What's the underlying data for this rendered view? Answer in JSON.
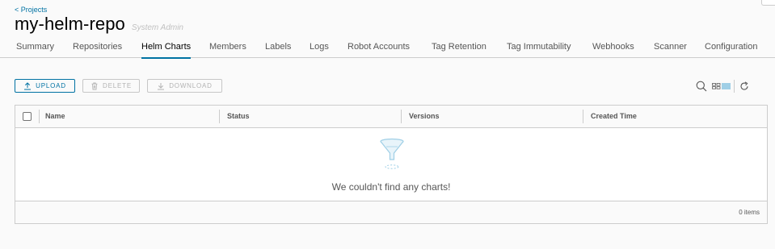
{
  "breadcrumb": {
    "back_label": "< Projects"
  },
  "project": {
    "name": "my-helm-repo",
    "role": "System Admin"
  },
  "tabs": [
    {
      "label": "Summary"
    },
    {
      "label": "Repositories"
    },
    {
      "label": "Helm Charts",
      "active": true
    },
    {
      "label": "Members"
    },
    {
      "label": "Labels"
    },
    {
      "label": "Logs"
    },
    {
      "label": "Robot Accounts"
    },
    {
      "label": "Tag Retention"
    },
    {
      "label": "Tag Immutability"
    },
    {
      "label": "Webhooks"
    },
    {
      "label": "Scanner"
    },
    {
      "label": "Configuration"
    }
  ],
  "toolbar": {
    "upload_label": "UPLOAD",
    "delete_label": "DELETE",
    "download_label": "DOWNLOAD",
    "icons": [
      "search-icon",
      "card-view-icon",
      "list-view-icon",
      "refresh-icon"
    ]
  },
  "table": {
    "columns": [
      "Name",
      "Status",
      "Versions",
      "Created Time"
    ],
    "empty_message": "We couldn't find any charts!",
    "footer_count": "0 items"
  },
  "colors": {
    "accent": "#0072a3",
    "border": "#cccccc",
    "text": "#565656",
    "disabled": "#b3b3b3",
    "empty_icon": "#9fcfe6"
  }
}
